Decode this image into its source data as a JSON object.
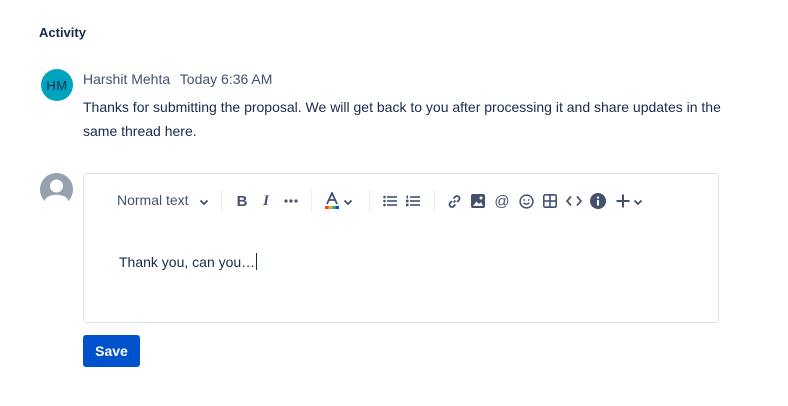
{
  "activity": {
    "heading": "Activity"
  },
  "comment": {
    "avatar_initials": "HM",
    "author": "Harshit Mehta",
    "timestamp": "Today 6:36 AM",
    "body": "Thanks for submitting the proposal. We will get back to you after processing it and share updates in the same thread here."
  },
  "editor": {
    "text_style": "Normal text",
    "content": "Thank you, can you…",
    "toolbar_icons": [
      "chevron-down-icon",
      "bold-icon",
      "italic-icon",
      "more-icon",
      "text-color-icon",
      "bullet-list-icon",
      "numbered-list-icon",
      "link-icon",
      "image-icon",
      "mention-icon",
      "emoji-icon",
      "table-icon",
      "code-icon",
      "info-icon",
      "plus-icon"
    ]
  },
  "save_label": "Save",
  "colors": {
    "accent": "#0052cc",
    "avatar": "#00a3bf",
    "text": "#172b4d"
  }
}
